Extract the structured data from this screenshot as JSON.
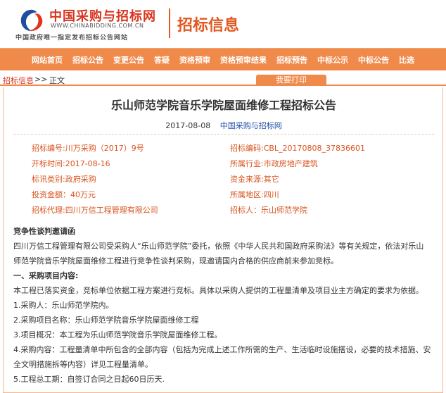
{
  "header": {
    "logo_name": "中国采购与招标网",
    "logo_url": "WWW.CHINABIDDING.COM.CN",
    "logo_tagline": "中国政府唯一指定发布招标公告网站",
    "section_title": "招标信息"
  },
  "colors": {
    "brand": "#d9341e",
    "nav": "#f08a4b",
    "accent_text": "#d9531e",
    "link": "#2350a8"
  },
  "nav": {
    "items": [
      "网站首页",
      "招标公告",
      "变更公告",
      "答疑",
      "资格预审",
      "资格预审结果",
      "招标预告",
      "中标公示",
      "中标公告",
      "比选"
    ]
  },
  "breadcrumb": {
    "link": "招标信息",
    "separator": ">>",
    "current": "正文"
  },
  "print_button": "我要打印",
  "notice": {
    "title": "乐山师范学院音乐学院屋面维修工程招标公告",
    "date": "2017-08-08",
    "source": "中国采购与招标网"
  },
  "info": {
    "left": [
      "招标编号:川万采购（2017）9号",
      "开标时间:2017-08-16",
      "标讯类别:政府采购",
      "投资金额：40万元",
      "招标代理:四川万信工程管理有限公司"
    ],
    "right": [
      "招标编码:CBL_20170808_37836601",
      "所属行业:市政房地产建筑",
      "资金来源:其它",
      "所属地区:四川",
      "招标人：乐山师范学院"
    ]
  },
  "body": {
    "heading": "竞争性谈判邀请函",
    "intro_line1": "四川万信工程管理有限公司受采购人“乐山师范学院”委托，依照《中华人民共和国政府采购法》等有关规定，依法对乐山",
    "intro_line2": "师范学院音乐学院屋面维修工程进行竞争性谈判采购，现邀请国内合格的供应商前来参加竞标。",
    "section1": "一、采购项目内容:",
    "line1": "本工程已落实资金，竞标单位依据工程方案进行竞标。具体以采购人提供的工程量清单及项目业主方确定的要求为依据。",
    "item1": "1.采购人：乐山师范学院内。",
    "item2": "2.采购项目名称：乐山师范学院音乐学院屋面维修工程",
    "item3": "3.项目概况：本工程为乐山师范学院音乐学院屋面维修工程。",
    "item4_line1": "4.采购内容：工程量清单中所包含的全部内容（包括为完成上述工作所需的生产、生活临时设施搭设，必要的技术措施、安",
    "item4_line2": "全文明措施拆等内容）详见工程量清单。",
    "item5": "5.工程总工期：自签订合同之日起60日历天."
  }
}
